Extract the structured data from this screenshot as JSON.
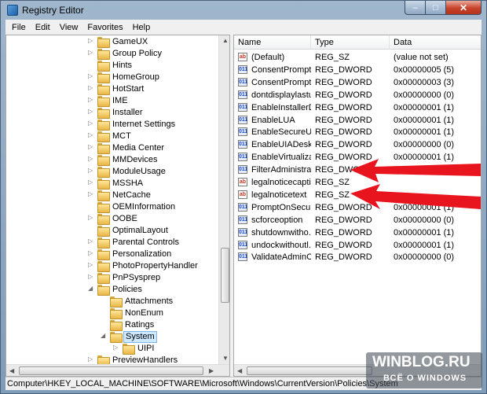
{
  "window": {
    "title": "Registry Editor",
    "caption_min": "–",
    "caption_max": "□",
    "caption_close": "✕"
  },
  "menu": [
    "File",
    "Edit",
    "View",
    "Favorites",
    "Help"
  ],
  "tree": [
    {
      "label": "GameUX",
      "level": 1,
      "expander": "collapsed"
    },
    {
      "label": "Group Policy",
      "level": 1,
      "expander": "collapsed"
    },
    {
      "label": "Hints",
      "level": 1,
      "expander": "none"
    },
    {
      "label": "HomeGroup",
      "level": 1,
      "expander": "collapsed"
    },
    {
      "label": "HotStart",
      "level": 1,
      "expander": "collapsed"
    },
    {
      "label": "IME",
      "level": 1,
      "expander": "collapsed"
    },
    {
      "label": "Installer",
      "level": 1,
      "expander": "collapsed"
    },
    {
      "label": "Internet Settings",
      "level": 1,
      "expander": "collapsed"
    },
    {
      "label": "MCT",
      "level": 1,
      "expander": "collapsed"
    },
    {
      "label": "Media Center",
      "level": 1,
      "expander": "collapsed"
    },
    {
      "label": "MMDevices",
      "level": 1,
      "expander": "collapsed"
    },
    {
      "label": "ModuleUsage",
      "level": 1,
      "expander": "collapsed"
    },
    {
      "label": "MSSHA",
      "level": 1,
      "expander": "collapsed"
    },
    {
      "label": "NetCache",
      "level": 1,
      "expander": "collapsed"
    },
    {
      "label": "OEMInformation",
      "level": 1,
      "expander": "none"
    },
    {
      "label": "OOBE",
      "level": 1,
      "expander": "collapsed"
    },
    {
      "label": "OptimalLayout",
      "level": 1,
      "expander": "none"
    },
    {
      "label": "Parental Controls",
      "level": 1,
      "expander": "collapsed"
    },
    {
      "label": "Personalization",
      "level": 1,
      "expander": "collapsed"
    },
    {
      "label": "PhotoPropertyHandler",
      "level": 1,
      "expander": "collapsed"
    },
    {
      "label": "PnPSysprep",
      "level": 1,
      "expander": "collapsed"
    },
    {
      "label": "Policies",
      "level": 1,
      "expander": "expanded"
    },
    {
      "label": "Attachments",
      "level": 2,
      "expander": "none"
    },
    {
      "label": "NonEnum",
      "level": 2,
      "expander": "none"
    },
    {
      "label": "Ratings",
      "level": 2,
      "expander": "none"
    },
    {
      "label": "System",
      "level": 2,
      "expander": "expanded",
      "selected": true
    },
    {
      "label": "UIPI",
      "level": 3,
      "expander": "collapsed"
    },
    {
      "label": "PreviewHandlers",
      "level": 1,
      "expander": "collapsed"
    }
  ],
  "list": {
    "columns": [
      "Name",
      "Type",
      "Data"
    ],
    "rows": [
      {
        "icon": "ab",
        "name": "(Default)",
        "type": "REG_SZ",
        "data": "(value not set)"
      },
      {
        "icon": "dw",
        "name": "ConsentPrompt...",
        "type": "REG_DWORD",
        "data": "0x00000005 (5)"
      },
      {
        "icon": "dw",
        "name": "ConsentPrompt...",
        "type": "REG_DWORD",
        "data": "0x00000003 (3)"
      },
      {
        "icon": "dw",
        "name": "dontdisplaylastu...",
        "type": "REG_DWORD",
        "data": "0x00000000 (0)"
      },
      {
        "icon": "dw",
        "name": "EnableInstallerD...",
        "type": "REG_DWORD",
        "data": "0x00000001 (1)"
      },
      {
        "icon": "dw",
        "name": "EnableLUA",
        "type": "REG_DWORD",
        "data": "0x00000001 (1)"
      },
      {
        "icon": "dw",
        "name": "EnableSecureUI...",
        "type": "REG_DWORD",
        "data": "0x00000001 (1)"
      },
      {
        "icon": "dw",
        "name": "EnableUIADeskt...",
        "type": "REG_DWORD",
        "data": "0x00000000 (0)"
      },
      {
        "icon": "dw",
        "name": "EnableVirtualizat...",
        "type": "REG_DWORD",
        "data": "0x00000001 (1)"
      },
      {
        "icon": "dw",
        "name": "FilterAdministra...",
        "type": "REG_DWORD",
        "data": "0x00000000 (0)"
      },
      {
        "icon": "ab",
        "name": "legalnoticecapti...",
        "type": "REG_SZ",
        "data": ""
      },
      {
        "icon": "ab",
        "name": "legalnoticetext",
        "type": "REG_SZ",
        "data": ""
      },
      {
        "icon": "dw",
        "name": "PromptOnSecur...",
        "type": "REG_DWORD",
        "data": "0x00000001 (1)"
      },
      {
        "icon": "dw",
        "name": "scforceoption",
        "type": "REG_DWORD",
        "data": "0x00000000 (0)"
      },
      {
        "icon": "dw",
        "name": "shutdownwitho...",
        "type": "REG_DWORD",
        "data": "0x00000001 (1)"
      },
      {
        "icon": "dw",
        "name": "undockwithoutl...",
        "type": "REG_DWORD",
        "data": "0x00000001 (1)"
      },
      {
        "icon": "dw",
        "name": "ValidateAdminC...",
        "type": "REG_DWORD",
        "data": "0x00000000 (0)"
      }
    ]
  },
  "status": "Computer\\HKEY_LOCAL_MACHINE\\SOFTWARE\\Microsoft\\Windows\\CurrentVersion\\Policies\\System",
  "watermark": {
    "title": "WINBLOG.RU",
    "subtitle": "ВСЁ О WINDOWS"
  },
  "colors": {
    "annotation_arrow": "#e8141e",
    "selection": "#cde8ff",
    "titlebar": "#9fb6cc"
  }
}
